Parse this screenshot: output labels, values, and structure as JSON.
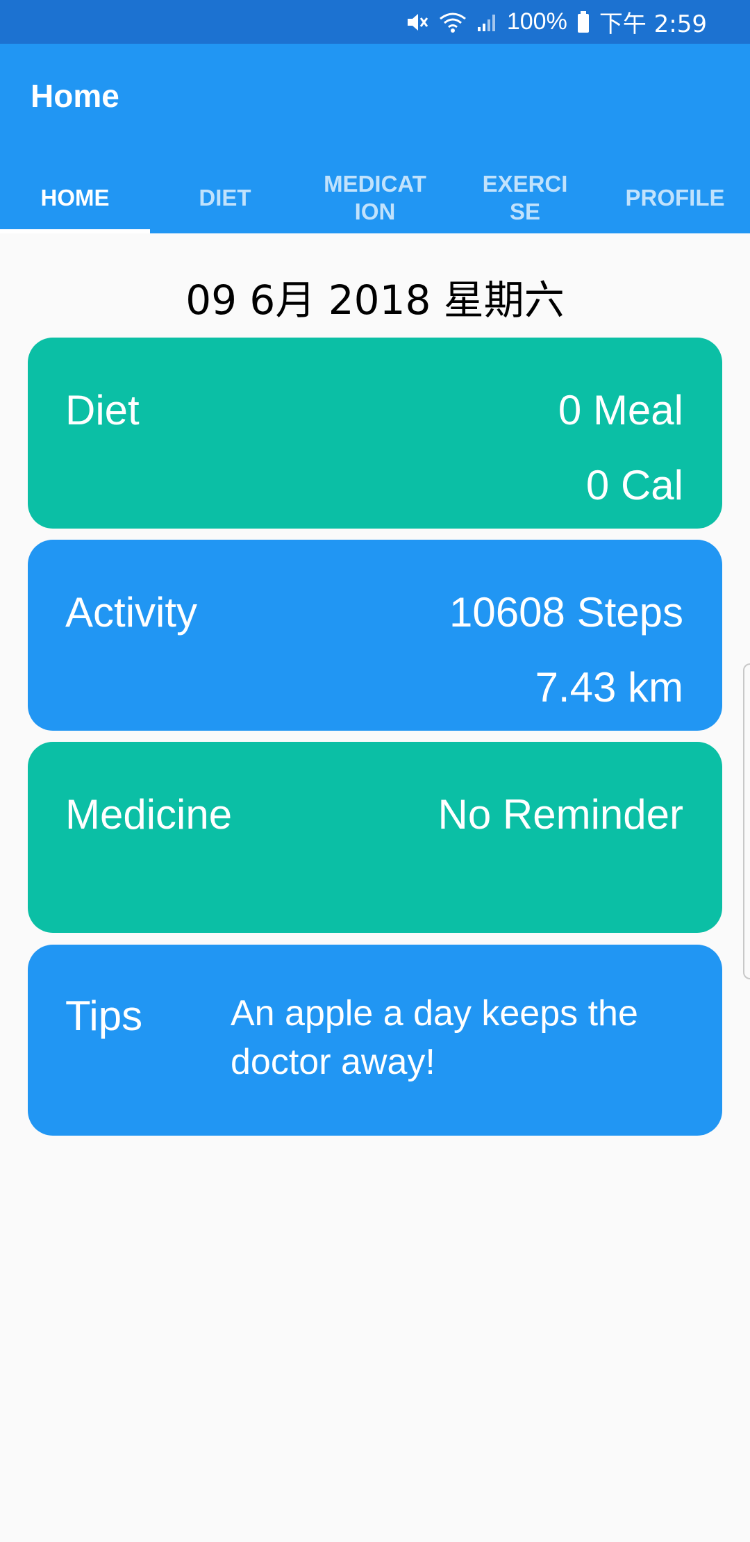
{
  "status_bar": {
    "battery": "100%",
    "time": "下午 2:59",
    "icons": [
      "mute-icon",
      "wifi-icon",
      "signal-icon",
      "battery-icon"
    ]
  },
  "app_bar": {
    "title": "Home",
    "tabs": [
      {
        "label": "HOME",
        "active": true
      },
      {
        "label": "DIET",
        "active": false
      },
      {
        "label": "MEDICATION",
        "active": false
      },
      {
        "label": "EXERCISE",
        "active": false
      },
      {
        "label": "PROFILE",
        "active": false
      }
    ]
  },
  "date": "09 6月 2018 星期六",
  "cards": {
    "diet": {
      "label": "Diet",
      "meals": "0 Meal",
      "calories": "0 Cal"
    },
    "activity": {
      "label": "Activity",
      "steps": "10608 Steps",
      "distance": "7.43 km"
    },
    "medicine": {
      "label": "Medicine",
      "status": "No Reminder"
    },
    "tips": {
      "label": "Tips",
      "text": "An apple a day keeps the doctor away!"
    }
  },
  "colors": {
    "status_bar": "#1c72d1",
    "primary": "#2196f3",
    "teal": "#0bbfa5",
    "background": "#fafafa"
  }
}
